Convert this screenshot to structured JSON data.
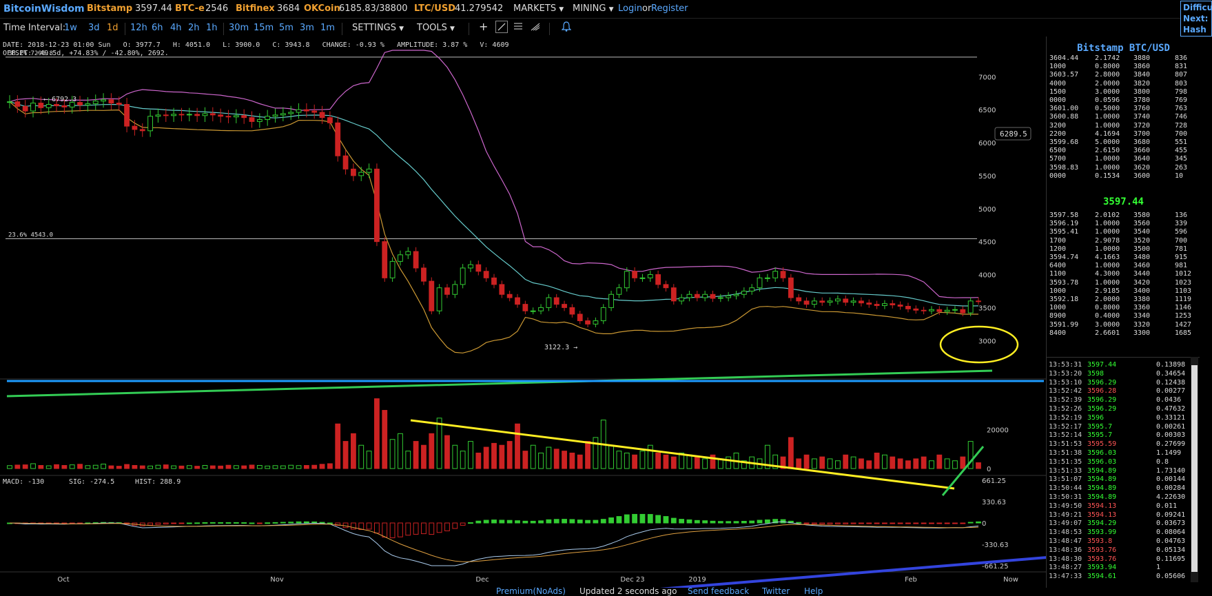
{
  "topbar": {
    "logo": "BitcoinWisdom",
    "exchanges": [
      {
        "name": "Bitstamp",
        "value": "3597.44"
      },
      {
        "name": "BTC-e",
        "value": "2546"
      },
      {
        "name": "Bitfinex",
        "value": "3684"
      },
      {
        "name": "OKCoin",
        "value": "6185.83/38800"
      },
      {
        "name": "LTC/USD",
        "value": "41.279542"
      }
    ],
    "markets": "MARKETS",
    "mining": "MINING",
    "login": "Login",
    "or": "or",
    "register": "Register",
    "difficulty_lines": [
      "Difficult",
      "Next:",
      "Hash Ra"
    ]
  },
  "toolbar": {
    "time_interval_label": "Time Interval:",
    "intervals": [
      {
        "label": "1w",
        "active": false
      },
      {
        "label": "3d",
        "active": false
      },
      {
        "label": "1d",
        "active": true
      },
      {
        "label": "12h",
        "active": false
      },
      {
        "label": "6h",
        "active": false
      },
      {
        "label": "4h",
        "active": false
      },
      {
        "label": "2h",
        "active": false
      },
      {
        "label": "1h",
        "active": false
      },
      {
        "label": "30m",
        "active": false
      },
      {
        "label": "15m",
        "active": false
      },
      {
        "label": "5m",
        "active": false
      },
      {
        "label": "3m",
        "active": false
      },
      {
        "label": "1m",
        "active": false
      }
    ],
    "settings": "SETTINGS",
    "tools": "TOOLS"
  },
  "info": {
    "line1": "DATE: 2018-12-23 01:00 Sun   O: 3977.7   H: 4051.0   L: 3900.0   C: 3943.8   CHANGE: -0.93 %   AMPLITUDE: 3.87 %   V: 4609",
    "line2": "OFFSET: -49.5d, +74.83% / -42.80%, 2692."
  },
  "chart_data": {
    "type": "candlestick",
    "price_axis": [
      7000,
      6500,
      6000,
      5500,
      5000,
      4500,
      4000,
      3500,
      3000
    ],
    "ylim": [
      2700,
      7400
    ],
    "x_labels": [
      "Oct",
      "Nov",
      "Dec",
      "Dec 23",
      "2019",
      "Feb",
      "Now"
    ],
    "fib_levels": [
      {
        "label": "38.2% 7296.8",
        "value": 7296.8
      },
      {
        "label": "23.6% 4543.0",
        "value": 4543.0
      }
    ],
    "annotations": {
      "high_marker": "← 6792.3",
      "low_marker": "3122.3 →",
      "price_tag": "6289.5"
    },
    "volume_axis": [
      20000,
      0
    ],
    "macd_axis": [
      "661.25",
      "330.63",
      "0",
      "-330.63",
      "-661.25"
    ],
    "macd_label": "MACD: -130",
    "sig_label": "SIG: -274.5",
    "hist_label": "HIST: 288.9",
    "closes": [
      6620,
      6550,
      6480,
      6600,
      6530,
      6580,
      6560,
      6540,
      6610,
      6570,
      6590,
      6630,
      6650,
      6600,
      6580,
      6250,
      6200,
      6180,
      6400,
      6420,
      6410,
      6430,
      6420,
      6430,
      6410,
      6440,
      6420,
      6400,
      6390,
      6410,
      6380,
      6320,
      6350,
      6400,
      6420,
      6440,
      6460,
      6500,
      6480,
      6460,
      6380,
      6300,
      5800,
      5600,
      5500,
      5550,
      5600,
      4500,
      3950,
      4200,
      4300,
      4350,
      4100,
      3900,
      3450,
      3800,
      3700,
      3850,
      4100,
      4150,
      4050,
      3950,
      3850,
      3700,
      3650,
      3550,
      3450,
      3450,
      3500,
      3650,
      3550,
      3500,
      3400,
      3300,
      3250,
      3300,
      3500,
      3700,
      3800,
      4050,
      3950,
      3950,
      4000,
      3850,
      3800,
      3600,
      3650,
      3700,
      3650,
      3700,
      3640,
      3650,
      3680,
      3700,
      3750,
      3800,
      3950,
      3950,
      4050,
      3950,
      3650,
      3600,
      3550,
      3600,
      3580,
      3600,
      3630,
      3580,
      3600,
      3570,
      3550,
      3530,
      3560,
      3540,
      3520,
      3480,
      3460,
      3450,
      3470,
      3440,
      3460,
      3470,
      3420,
      3600,
      3597
    ],
    "volumes": [
      1500,
      1800,
      1900,
      2500,
      1600,
      1400,
      2000,
      1600,
      1900,
      2200,
      1500,
      1700,
      2300,
      1400,
      1200,
      2100,
      1600,
      1400,
      1300,
      1700,
      1900,
      1400,
      1300,
      1500,
      1200,
      1600,
      1400,
      1300,
      1700,
      1500,
      1400,
      1800,
      1600,
      1300,
      1500,
      1400,
      1700,
      1500,
      1600,
      1700,
      2200,
      2500,
      23000,
      14000,
      18000,
      12000,
      9000,
      36000,
      30000,
      15000,
      18000,
      9000,
      14000,
      12000,
      18000,
      26000,
      17000,
      12000,
      9000,
      14000,
      8000,
      11000,
      13000,
      12000,
      14000,
      23000,
      9000,
      12000,
      8000,
      11000,
      10000,
      9000,
      8000,
      7000,
      14000,
      16000,
      25000,
      12000,
      9000,
      8000,
      7000,
      9000,
      12000,
      8000,
      7000,
      6000,
      8000,
      7000,
      6000,
      5000,
      7000,
      5000,
      6000,
      8000,
      4000,
      6000,
      5000,
      12000,
      7000,
      6000,
      16000,
      5000,
      7000,
      5000,
      6000,
      5000,
      4000,
      7000,
      6000,
      5000,
      4000,
      8000,
      7000,
      6000,
      5000,
      4000,
      5000,
      6000,
      4000,
      7000,
      5000,
      4000,
      6000,
      14000,
      3000
    ]
  },
  "orderbook": {
    "title": "Bitstamp BTC/USD",
    "asks": [
      [
        "3604.44",
        "2.1742",
        "3880",
        "836"
      ],
      [
        "1000",
        "0.8000",
        "3860",
        "831"
      ],
      [
        "3603.57",
        "2.8000",
        "3840",
        "807"
      ],
      [
        "4000",
        "2.0000",
        "3820",
        "803"
      ],
      [
        "1500",
        "3.0000",
        "3800",
        "798"
      ],
      [
        "0000",
        "0.0596",
        "3780",
        "769"
      ],
      [
        "3601.00",
        "0.5000",
        "3760",
        "763"
      ],
      [
        "3600.88",
        "1.0000",
        "3740",
        "746"
      ],
      [
        "3200",
        "1.0000",
        "3720",
        "728"
      ],
      [
        "2200",
        "4.1694",
        "3700",
        "700"
      ],
      [
        "3599.68",
        "5.0000",
        "3680",
        "551"
      ],
      [
        "6500",
        "2.6150",
        "3660",
        "455"
      ],
      [
        "5700",
        "1.0000",
        "3640",
        "345"
      ],
      [
        "3598.83",
        "1.0000",
        "3620",
        "263"
      ],
      [
        "0000",
        "0.1534",
        "3600",
        "10"
      ]
    ],
    "last_price": "3597.44",
    "bids": [
      [
        "3597.58",
        "2.0102",
        "3580",
        "136"
      ],
      [
        "3596.19",
        "1.0000",
        "3560",
        "339"
      ],
      [
        "3595.41",
        "1.0000",
        "3540",
        "596"
      ],
      [
        "1700",
        "2.9078",
        "3520",
        "700"
      ],
      [
        "1200",
        "1.0000",
        "3500",
        "781"
      ],
      [
        "3594.74",
        "4.1663",
        "3480",
        "915"
      ],
      [
        "6400",
        "1.0000",
        "3460",
        "981"
      ],
      [
        "1100",
        "4.3000",
        "3440",
        "1012"
      ],
      [
        "3593.78",
        "1.0000",
        "3420",
        "1023"
      ],
      [
        "1000",
        "2.9185",
        "3400",
        "1103"
      ],
      [
        "3592.18",
        "2.0000",
        "3380",
        "1119"
      ],
      [
        "1000",
        "0.8000",
        "3360",
        "1146"
      ],
      [
        "8900",
        "0.4000",
        "3340",
        "1253"
      ],
      [
        "3591.99",
        "3.0000",
        "3320",
        "1427"
      ],
      [
        "8400",
        "2.6601",
        "3300",
        "1685"
      ]
    ]
  },
  "trades": [
    [
      "13:53:31",
      "3597.44",
      "0.13898",
      "buy"
    ],
    [
      "13:53:20",
      "3598",
      "0.34654",
      "buy"
    ],
    [
      "13:53:10",
      "3596.29",
      "0.12438",
      "buy"
    ],
    [
      "13:52:42",
      "3596.28",
      "0.00277",
      "sell"
    ],
    [
      "13:52:39",
      "3596.29",
      "0.0436",
      "buy"
    ],
    [
      "13:52:26",
      "3596.29",
      "0.47632",
      "buy"
    ],
    [
      "13:52:19",
      "3596",
      "0.33121",
      "buy"
    ],
    [
      "13:52:17",
      "3595.7",
      "0.00261",
      "buy"
    ],
    [
      "13:52:14",
      "3595.7",
      "0.00303",
      "buy"
    ],
    [
      "13:51:53",
      "3595.59",
      "0.27699",
      "sell"
    ],
    [
      "13:51:38",
      "3596.03",
      "1.1499",
      "buy"
    ],
    [
      "13:51:35",
      "3596.03",
      "0.8",
      "buy"
    ],
    [
      "13:51:33",
      "3594.89",
      "1.73140",
      "buy"
    ],
    [
      "13:51:07",
      "3594.89",
      "0.00144",
      "buy"
    ],
    [
      "13:50:44",
      "3594.89",
      "0.00284",
      "buy"
    ],
    [
      "13:50:31",
      "3594.89",
      "4.22630",
      "buy"
    ],
    [
      "13:49:50",
      "3594.13",
      "0.011",
      "sell"
    ],
    [
      "13:49:21",
      "3594.13",
      "0.09241",
      "sell"
    ],
    [
      "13:49:07",
      "3594.29",
      "0.03673",
      "buy"
    ],
    [
      "13:48:53",
      "3593.99",
      "0.08064",
      "buy"
    ],
    [
      "13:48:47",
      "3593.8",
      "0.04763",
      "sell"
    ],
    [
      "13:48:36",
      "3593.76",
      "0.05134",
      "sell"
    ],
    [
      "13:48:30",
      "3593.76",
      "0.11695",
      "sell"
    ],
    [
      "13:48:27",
      "3593.94",
      "1",
      "buy"
    ],
    [
      "13:47:33",
      "3594.61",
      "0.05606",
      "buy"
    ]
  ],
  "footer": {
    "premium": "Premium(NoAds)",
    "updated": "Updated 2 seconds ago",
    "feedback": "Send feedback",
    "twitter": "Twitter",
    "help": "Help"
  },
  "colors": {
    "up": "#33cc33",
    "down": "#cc2222",
    "accent": "#5aa9ff",
    "exchange": "#f0a030"
  }
}
